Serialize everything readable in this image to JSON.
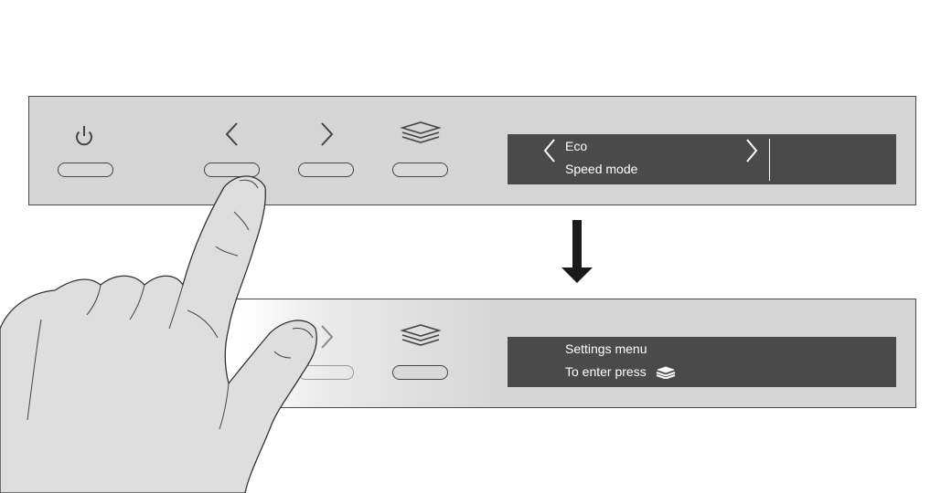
{
  "top_panel": {
    "buttons": [
      "power",
      "left",
      "right",
      "menu"
    ],
    "display": {
      "line1": "Eco",
      "line2": "Speed mode",
      "left_arrow_icon": "chevron-left-icon",
      "right_arrow_icon": "chevron-right-icon"
    }
  },
  "transition_arrow_icon": "arrow-down-icon",
  "bottom_panel": {
    "display": {
      "line1": "Settings menu",
      "line2": "To enter press",
      "inline_icon": "layers-icon"
    }
  },
  "colors": {
    "panel": "#d5d5d5",
    "display": "#4a4a4a",
    "display_text": "#ffffff",
    "outline": "#4a4a4a"
  }
}
